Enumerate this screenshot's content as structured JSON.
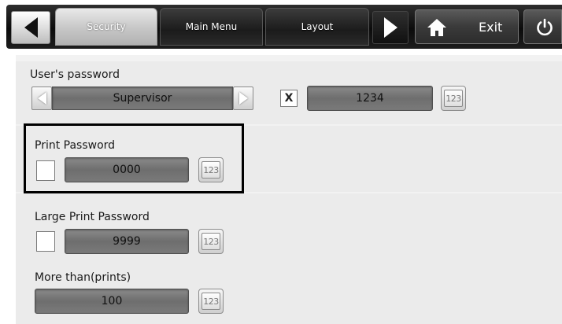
{
  "toolbar": {
    "tabs": [
      {
        "label": "Security",
        "active": true
      },
      {
        "label": "Main Menu",
        "active": false
      },
      {
        "label": "Layout",
        "active": false
      }
    ],
    "exit_label": "Exit",
    "icons": [
      "arrow-left-icon",
      "arrow-right-icon",
      "home-icon",
      "power-icon"
    ]
  },
  "users_password": {
    "label": "User's password",
    "user_selector_value": "Supervisor",
    "checkbox_checked": true,
    "checkbox_mark": "X",
    "password_value": "1234",
    "keypad_label": "123"
  },
  "print_password": {
    "label": "Print Password",
    "checkbox_checked": false,
    "password_value": "0000",
    "keypad_label": "123"
  },
  "large_print_password": {
    "label": "Large Print Password",
    "checkbox_checked": false,
    "password_value": "9999",
    "keypad_label": "123"
  },
  "more_than_prints": {
    "label": "More than(prints)",
    "value": "100",
    "keypad_label": "123"
  },
  "colors": {
    "toolbar_bg": "#111111",
    "field_bg": "#7a7a7a",
    "panel_bg": "#ebebeb",
    "highlight_border": "#000000"
  }
}
